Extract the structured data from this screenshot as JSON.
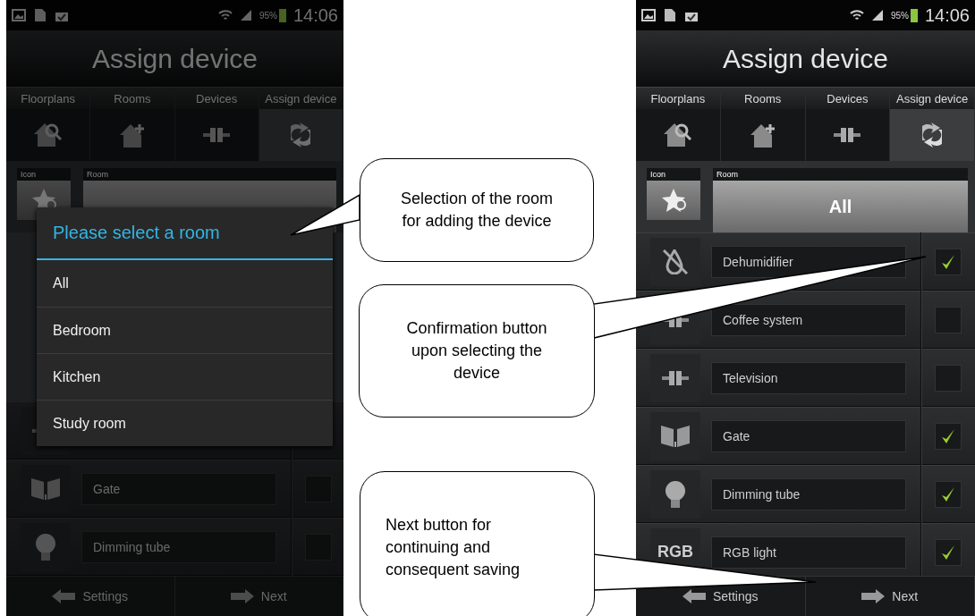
{
  "screens": [
    {
      "dimmed": true,
      "status_bar": {
        "battery": "95%",
        "time": "14:06"
      },
      "title": "Assign device",
      "tabs": [
        {
          "label": "Floorplans",
          "kind": "home-search",
          "selected": false
        },
        {
          "label": "Rooms",
          "kind": "home-plus",
          "selected": false
        },
        {
          "label": "Devices",
          "kind": "plug",
          "selected": false
        },
        {
          "label": "Assign device",
          "kind": "sync",
          "selected": true
        }
      ],
      "icon_label": "Icon",
      "room_label": "Room",
      "devices": [
        {
          "kind": "plug"
        },
        {
          "kind": "gate",
          "name": "Gate",
          "checked": false
        },
        {
          "kind": "bulb",
          "name": "Dimming tube",
          "checked": false
        }
      ],
      "bottom_bar": {
        "back": "Settings",
        "next": "Next"
      },
      "dialog": {
        "title": "Please select a room",
        "options": [
          "All",
          "Bedroom",
          "Kitchen",
          "Study room"
        ]
      }
    },
    {
      "dimmed": false,
      "status_bar": {
        "battery": "95%",
        "time": "14:06"
      },
      "title": "Assign device",
      "tabs": [
        {
          "label": "Floorplans",
          "kind": "home-search",
          "selected": false
        },
        {
          "label": "Rooms",
          "kind": "home-plus",
          "selected": false
        },
        {
          "label": "Devices",
          "kind": "plug",
          "selected": false
        },
        {
          "label": "Assign device",
          "kind": "sync",
          "selected": true
        }
      ],
      "icon_label": "Icon",
      "room_label": "Room",
      "room_value": "All",
      "devices": [
        {
          "kind": "drop",
          "name": "Dehumidifier",
          "checked": true
        },
        {
          "kind": "plug",
          "name": "Coffee system",
          "checked": false
        },
        {
          "kind": "plug",
          "name": "Television",
          "checked": false
        },
        {
          "kind": "gate",
          "name": "Gate",
          "checked": true
        },
        {
          "kind": "bulb",
          "name": "Dimming tube",
          "checked": true
        },
        {
          "kind": "text",
          "icon_text": "RGB",
          "name": "RGB light",
          "checked": true
        }
      ],
      "bottom_bar": {
        "back": "Settings",
        "next": "Next"
      }
    }
  ],
  "callouts": [
    {
      "text": "Selection of the room for adding the device"
    },
    {
      "text": "Confirmation button upon selecting the device"
    },
    {
      "text": "Next button for continuing and consequent saving"
    }
  ]
}
